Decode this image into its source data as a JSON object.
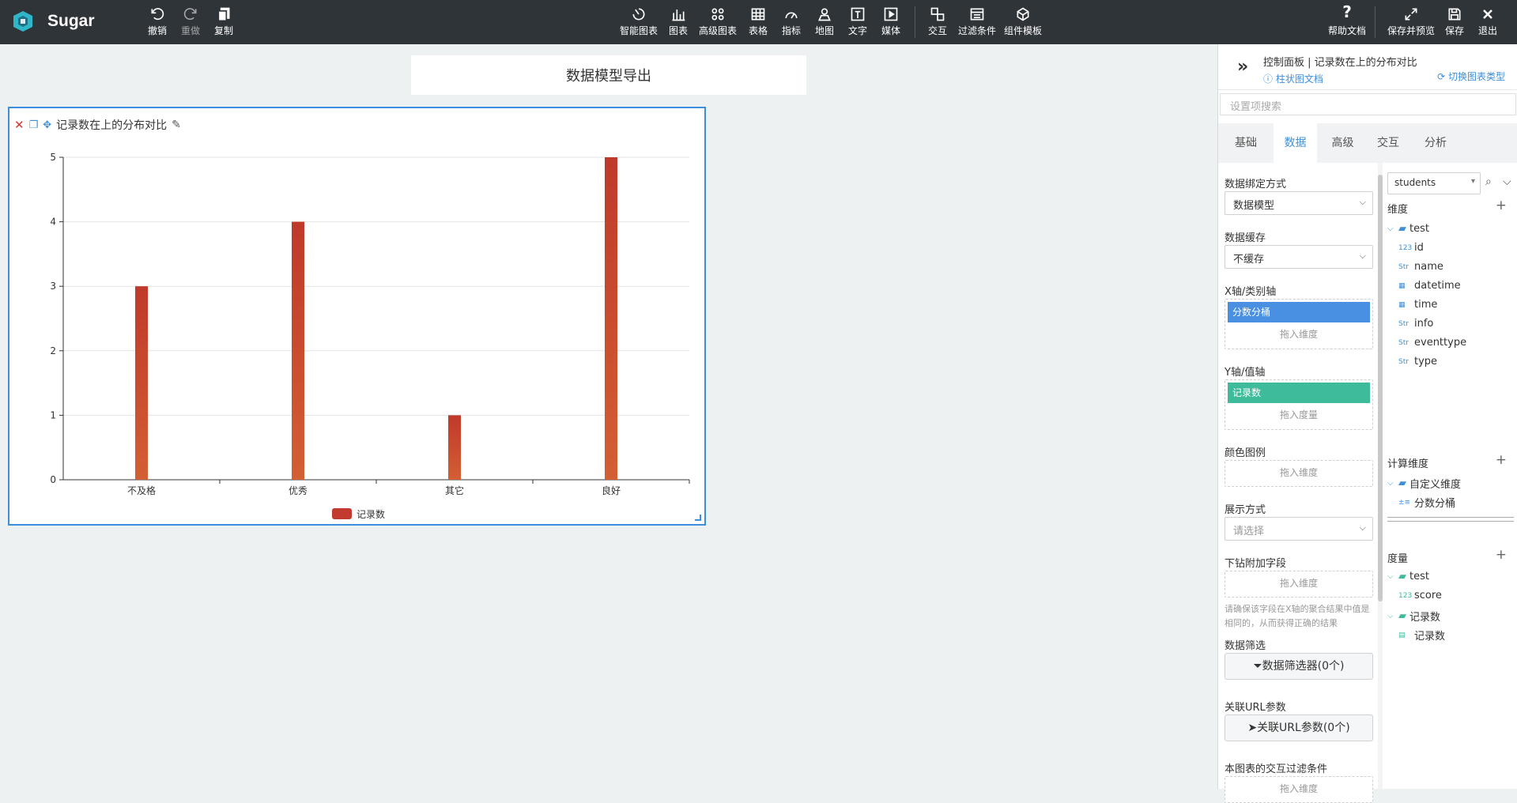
{
  "app": {
    "name": "Sugar"
  },
  "toolbar": {
    "undo": "撤销",
    "redo": "重做",
    "copy": "复制",
    "smart_chart": "智能图表",
    "chart": "图表",
    "adv_chart": "高级图表",
    "table": "表格",
    "metric": "指标",
    "map": "地图",
    "text": "文字",
    "media": "媒体",
    "interact": "交互",
    "filter": "过滤条件",
    "template": "组件模板",
    "help": "帮助文档",
    "save_preview": "保存并预览",
    "save": "保存",
    "exit": "退出"
  },
  "page": {
    "title": "数据模型导出"
  },
  "card": {
    "title": "记录数在上的分布对比"
  },
  "chart_data": {
    "type": "bar",
    "categories": [
      "不及格",
      "优秀",
      "其它",
      "良好"
    ],
    "series": [
      {
        "name": "记录数",
        "values": [
          3,
          4,
          1,
          5
        ],
        "color": "#c23b2e"
      }
    ],
    "ylim": [
      0,
      5
    ],
    "yticks": [
      0,
      1,
      2,
      3,
      4,
      5
    ],
    "legend_position": "bottom-center",
    "grid": true
  },
  "panel": {
    "title": "控制面板 | 记录数在上的分布对比",
    "doc_link": "柱状图文档",
    "switch_type": "切换图表类型",
    "search_placeholder": "设置项搜索",
    "tabs": [
      "基础",
      "数据",
      "高级",
      "交互",
      "分析"
    ],
    "active_tab": "数据",
    "bind_label": "数据绑定方式",
    "bind_value": "数据模型",
    "cache_label": "数据缓存",
    "cache_value": "不缓存",
    "x_label": "X轴/类别轴",
    "x_pill": "分数分桶",
    "drop_dim": "拖入维度",
    "y_label": "Y轴/值轴",
    "y_pill": "记录数",
    "drop_measure": "拖入度量",
    "color_label": "颜色图例",
    "display_label": "展示方式",
    "display_placeholder": "请选择",
    "drill_label": "下钻附加字段",
    "drill_note": "请确保该字段在X轴的聚合结果中值是相同的，从而获得正确的结果",
    "filter_label": "数据筛选",
    "filter_btn": "数据筛选器(0个)",
    "url_label": "关联URL参数",
    "url_btn": "关联URL参数(0个)",
    "interact_label": "本图表的交互过滤条件",
    "pill_x_color": "#4a90e2",
    "pill_y_color": "#3dbb9b"
  },
  "fields": {
    "dataset": "students",
    "dim_label": "维度",
    "dim_folder": "test",
    "dims": [
      {
        "type": "123",
        "name": "id"
      },
      {
        "type": "Str",
        "name": "name"
      },
      {
        "type": "date",
        "name": "datetime"
      },
      {
        "type": "date",
        "name": "time"
      },
      {
        "type": "Str",
        "name": "info"
      },
      {
        "type": "Str",
        "name": "eventtype"
      },
      {
        "type": "Str",
        "name": "type"
      }
    ],
    "calc_label": "计算维度",
    "calc_folder": "自定义维度",
    "calc_item": "分数分桶",
    "measure_label": "度量",
    "measure_folder": "test",
    "measure_item": "score",
    "measure_type": "123",
    "count_folder": "记录数",
    "count_item": "记录数"
  }
}
